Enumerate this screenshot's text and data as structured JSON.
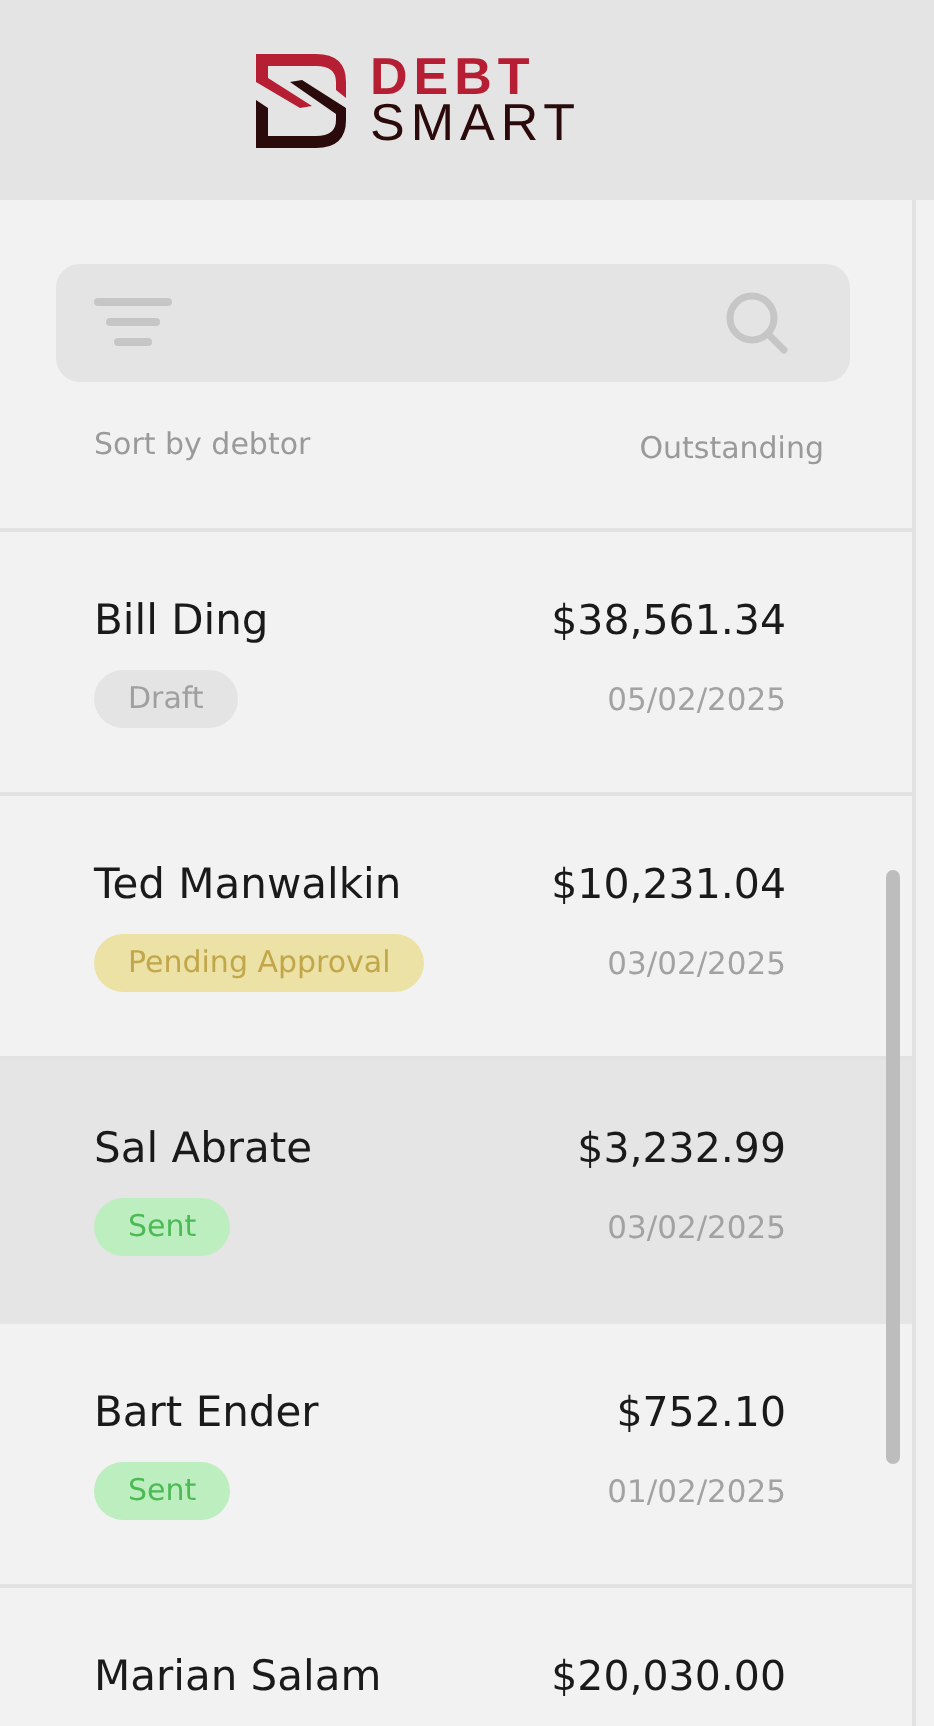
{
  "header": {
    "logo_top": "DEBT",
    "logo_bottom": "SMART"
  },
  "toolbar": {
    "sort_label": "Sort by debtor",
    "column_label": "Outstanding"
  },
  "debtors": [
    {
      "name": "Bill Ding",
      "amount": "$38,561.34",
      "status": {
        "label": "Draft",
        "kind": "draft"
      },
      "date": "05/02/2025",
      "selected": false
    },
    {
      "name": "Ted Manwalkin",
      "amount": "$10,231.04",
      "status": {
        "label": "Pending Approval",
        "kind": "pending"
      },
      "date": "03/02/2025",
      "selected": false
    },
    {
      "name": "Sal Abrate",
      "amount": "$3,232.99",
      "status": {
        "label": "Sent",
        "kind": "sent"
      },
      "date": "03/02/2025",
      "selected": true
    },
    {
      "name": "Bart Ender",
      "amount": "$752.10",
      "status": {
        "label": "Sent",
        "kind": "sent"
      },
      "date": "01/02/2025",
      "selected": false
    },
    {
      "name": "Marian Salam",
      "amount": "$20,030.00",
      "selected": false
    }
  ]
}
